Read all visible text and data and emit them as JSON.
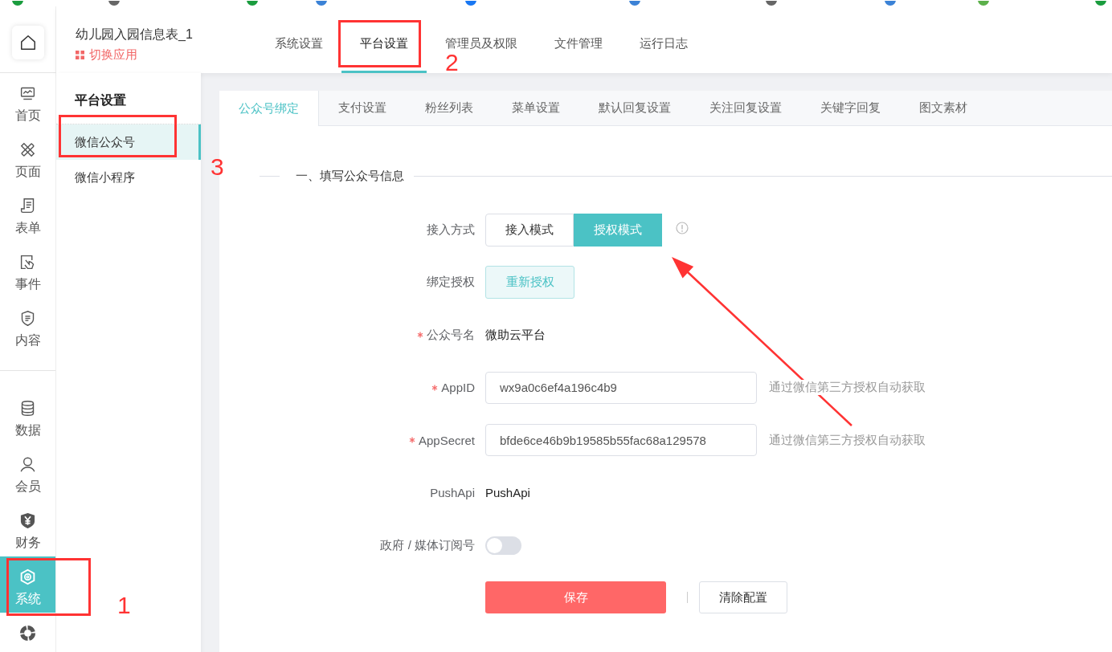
{
  "app": {
    "title": "幼儿园入园信息表_1",
    "switch_label": "切换应用"
  },
  "top_nav": [
    {
      "label": "系统设置",
      "selected": false
    },
    {
      "label": "平台设置",
      "selected": true
    },
    {
      "label": "管理员及权限",
      "selected": false
    },
    {
      "label": "文件管理",
      "selected": false
    },
    {
      "label": "运行日志",
      "selected": false
    }
  ],
  "rail": {
    "top": [
      {
        "label": "首页",
        "selected": false
      },
      {
        "label": "页面",
        "selected": false
      },
      {
        "label": "表单",
        "selected": false
      },
      {
        "label": "事件",
        "selected": false
      },
      {
        "label": "内容",
        "selected": false
      }
    ],
    "bottom": [
      {
        "label": "数据",
        "selected": false
      },
      {
        "label": "会员",
        "selected": false
      },
      {
        "label": "财务",
        "selected": false
      },
      {
        "label": "系统",
        "selected": true
      },
      {
        "selected": false
      }
    ]
  },
  "subnav": {
    "title": "平台设置",
    "items": [
      {
        "label": "微信公众号",
        "selected": true
      },
      {
        "label": "微信小程序",
        "selected": false
      }
    ]
  },
  "tabs": [
    {
      "label": "公众号绑定",
      "selected": true
    },
    {
      "label": "支付设置",
      "selected": false
    },
    {
      "label": "粉丝列表",
      "selected": false
    },
    {
      "label": "菜单设置",
      "selected": false
    },
    {
      "label": "默认回复设置",
      "selected": false
    },
    {
      "label": "关注回复设置",
      "selected": false
    },
    {
      "label": "关键字回复",
      "selected": false
    },
    {
      "label": "图文素材",
      "selected": false
    }
  ],
  "section_title": "一、填写公众号信息",
  "form": {
    "rows": [
      {
        "kind": "segmented",
        "label": "接入方式",
        "required": false,
        "options": [
          {
            "label": "接入模式",
            "selected": false
          },
          {
            "label": "授权模式",
            "selected": true
          }
        ]
      },
      {
        "kind": "button",
        "label": "绑定授权",
        "required": false,
        "button": "重新授权"
      },
      {
        "kind": "text",
        "label": "公众号名",
        "required": true,
        "value": "微助云平台"
      },
      {
        "kind": "input",
        "label": "AppID",
        "required": true,
        "value": "wx9a0c6ef4a196c4b9",
        "hint": "通过微信第三方授权自动获取"
      },
      {
        "kind": "input",
        "label": "AppSecret",
        "required": true,
        "value": "bfde6ce46b9b19585b55fac68a129578",
        "hint": "通过微信第三方授权自动获取"
      },
      {
        "kind": "text",
        "label": "PushApi",
        "required": false,
        "value": "PushApi"
      },
      {
        "kind": "toggle",
        "label": "政府 / 媒体订阅号",
        "required": false,
        "on": false
      }
    ]
  },
  "actions": [
    {
      "kind": "primary",
      "label": "保存"
    },
    {
      "kind": "default",
      "label": "清除配置"
    }
  ],
  "annotations": [
    {
      "label": "1"
    },
    {
      "label": "2"
    },
    {
      "label": "3"
    }
  ]
}
